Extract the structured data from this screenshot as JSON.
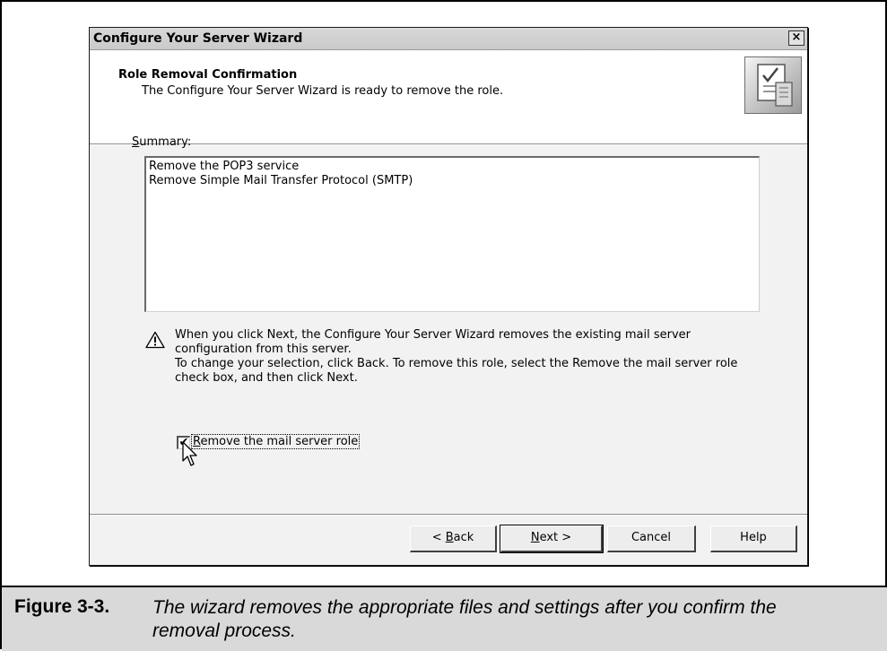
{
  "window": {
    "title": "Configure Your Server Wizard",
    "close_glyph": "×"
  },
  "header": {
    "title": "Role Removal Confirmation",
    "subtitle": "The Configure Your Server Wizard is ready to remove the role.",
    "icon": "wizard-checklist-icon"
  },
  "summary": {
    "label_accel": "S",
    "label_rest": "ummary:",
    "lines": [
      "Remove the POP3 service",
      "Remove Simple Mail Transfer Protocol (SMTP)"
    ]
  },
  "warning": {
    "icon": "warning-icon",
    "line1": "When you click Next, the Configure Your Server Wizard removes the existing mail server",
    "line2": "configuration from this server.",
    "line3": "To change your selection, click Back. To remove this role, select the Remove the mail server role",
    "line4": "check box, and then click Next."
  },
  "checkbox": {
    "checked": true,
    "check_glyph": "✔",
    "label_accel": "R",
    "label_rest": "emove the mail server role"
  },
  "buttons": {
    "back_prefix": "< ",
    "back_accel": "B",
    "back_rest": "ack",
    "next_accel": "N",
    "next_rest": "ext >",
    "cancel": "Cancel",
    "help": "Help"
  },
  "caption": {
    "label": "Figure 3-3.",
    "text": "The wizard removes the appropriate files and settings after you confirm the removal process."
  }
}
